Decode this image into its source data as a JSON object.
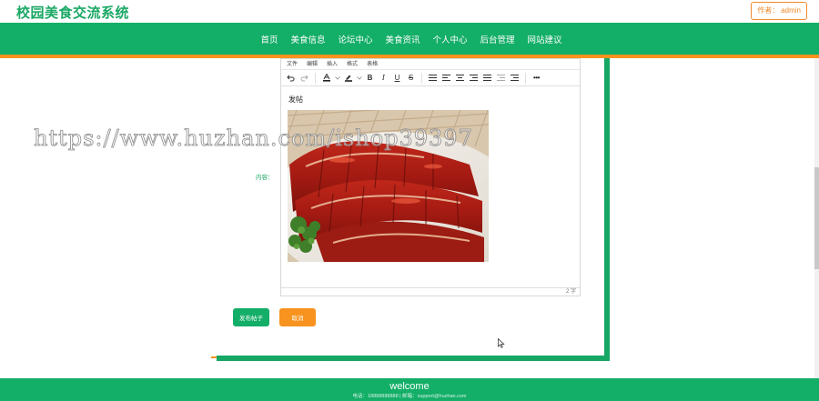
{
  "site": {
    "title": "校园美食交流系统"
  },
  "author": {
    "label": "作者：",
    "name": "admin"
  },
  "nav": {
    "items": [
      {
        "label": "首页"
      },
      {
        "label": "美食信息"
      },
      {
        "label": "论坛中心"
      },
      {
        "label": "美食资讯"
      },
      {
        "label": "个人中心"
      },
      {
        "label": "后台管理"
      },
      {
        "label": "网站建议"
      }
    ]
  },
  "editor": {
    "menu": [
      "文件",
      "编辑",
      "插入",
      "格式",
      "表格"
    ],
    "body_text": "发帖",
    "status": "2 字"
  },
  "form": {
    "content_label": "内容："
  },
  "buttons": {
    "submit": "发布帖子",
    "cancel": "取消"
  },
  "watermark": "https://www.huzhan.com/ishop39397",
  "footer": {
    "welcome": "welcome",
    "contact": "电话：18888888888 | 邮箱：support@huzhan.com"
  },
  "colors": {
    "brand": "#13ae67",
    "accent": "#f7931e",
    "title": "#1aa865"
  }
}
